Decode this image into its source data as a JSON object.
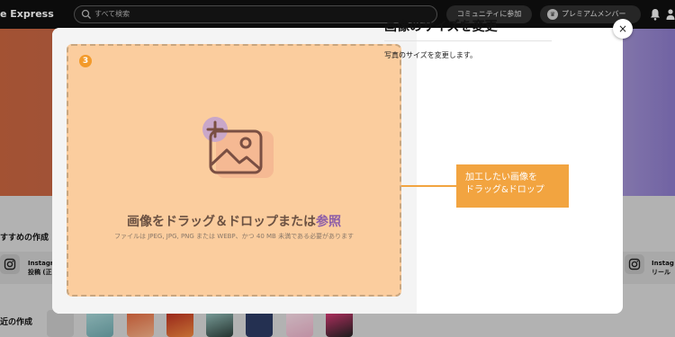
{
  "topbar": {
    "brand": "e Express",
    "search_placeholder": "すべて検索",
    "community_label": "コミュニティに参加",
    "premium_label": "プレミアムメンバー"
  },
  "background": {
    "recommended_heading": "すすめの作成",
    "recent_heading": "近の作成",
    "left_card_line1": "Instagr",
    "left_card_line2": "投稿 (正",
    "right_card_line1": "Instag",
    "right_card_line2": "リール"
  },
  "modal": {
    "step_number": "3",
    "drop_title_main": "画像をドラッグ＆ドロップまたは",
    "drop_title_link": "参照",
    "drop_subtitle": "ファイルは JPEG, JPG, PNG または WEBP、かつ 40 MB 未満である必要があります",
    "panel_title": "画像のサイズを変更",
    "panel_description": "写真のサイズを変更します。",
    "close_label": "×"
  },
  "callout": {
    "line1": "加工したい画像を",
    "line2": "ドラッグ&ドロップ"
  },
  "colors": {
    "dropzone_fill": "#fbcd9e",
    "accent_orange": "#f2a440",
    "link_purple": "#8e5fa8"
  },
  "icons": [
    "search-icon",
    "crown-icon",
    "bell-icon",
    "user-icon",
    "instagram-icon",
    "image-add-icon",
    "close-icon"
  ]
}
